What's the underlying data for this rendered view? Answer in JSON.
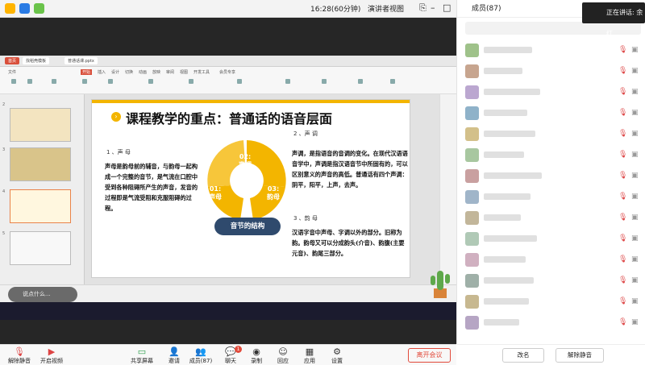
{
  "meeting": {
    "time": "16:28(60分钟)",
    "view_label": "演讲者视图"
  },
  "members_panel": {
    "title": "成员(87)",
    "rename_label": "改名",
    "unmute_all_label": "解除静音",
    "speaking_label": "正在讲话: 余红"
  },
  "ppt": {
    "tab_home": "首页",
    "tab_template": "找稻壳模板",
    "tab_file": "普通话课.pptx",
    "menus": [
      "文件",
      "开始",
      "插入",
      "设计",
      "切换",
      "动画",
      "放映",
      "审阅",
      "视图",
      "开发工具",
      "会员专享"
    ],
    "slide_title": "课程教学的重点：普通话的语音层面",
    "section1_head": "1 、声 母",
    "section1_body": "声母是韵母前的辅音，与韵母一起构成一个完整的音节，是气流在口腔中受到各种阻碍所产生的声音，发音的过程即是气流受阻和克服阻碍的过程。",
    "section2_head": "2 、声 调",
    "section2_body": "声调，是指语音的音调的变化。在现代汉语语音学中，声调是指汉语音节中所固有的，可以区别意义的声音的高低。普通话有四个声调：阴平，阳平，上声，去声。",
    "section3_head": "3 、韵 母",
    "section3_body": "汉语字音中声母、字调以外的部分。旧称为韵。韵母又可以分成韵头(介音)、韵腹(主要元音)、韵尾三部分。",
    "seg1": "01:\n声母",
    "seg2": "02:\n声调",
    "seg3": "03:\n韵母",
    "center": "音节的结构",
    "comment_placeholder": "说点什么..."
  },
  "toolbar": {
    "unmute": "解除静音",
    "video": "开启视频",
    "share": "共享屏幕",
    "invite": "邀请",
    "members": "成员(87)",
    "chat": "聊天",
    "record": "录制",
    "reactions": "回应",
    "apps": "应用",
    "settings": "设置",
    "leave": "离开会议",
    "chat_badge": "1"
  },
  "colors": {
    "accent": "#f3b500",
    "navy": "#2f4a6d",
    "leave": "#e24a3b"
  }
}
